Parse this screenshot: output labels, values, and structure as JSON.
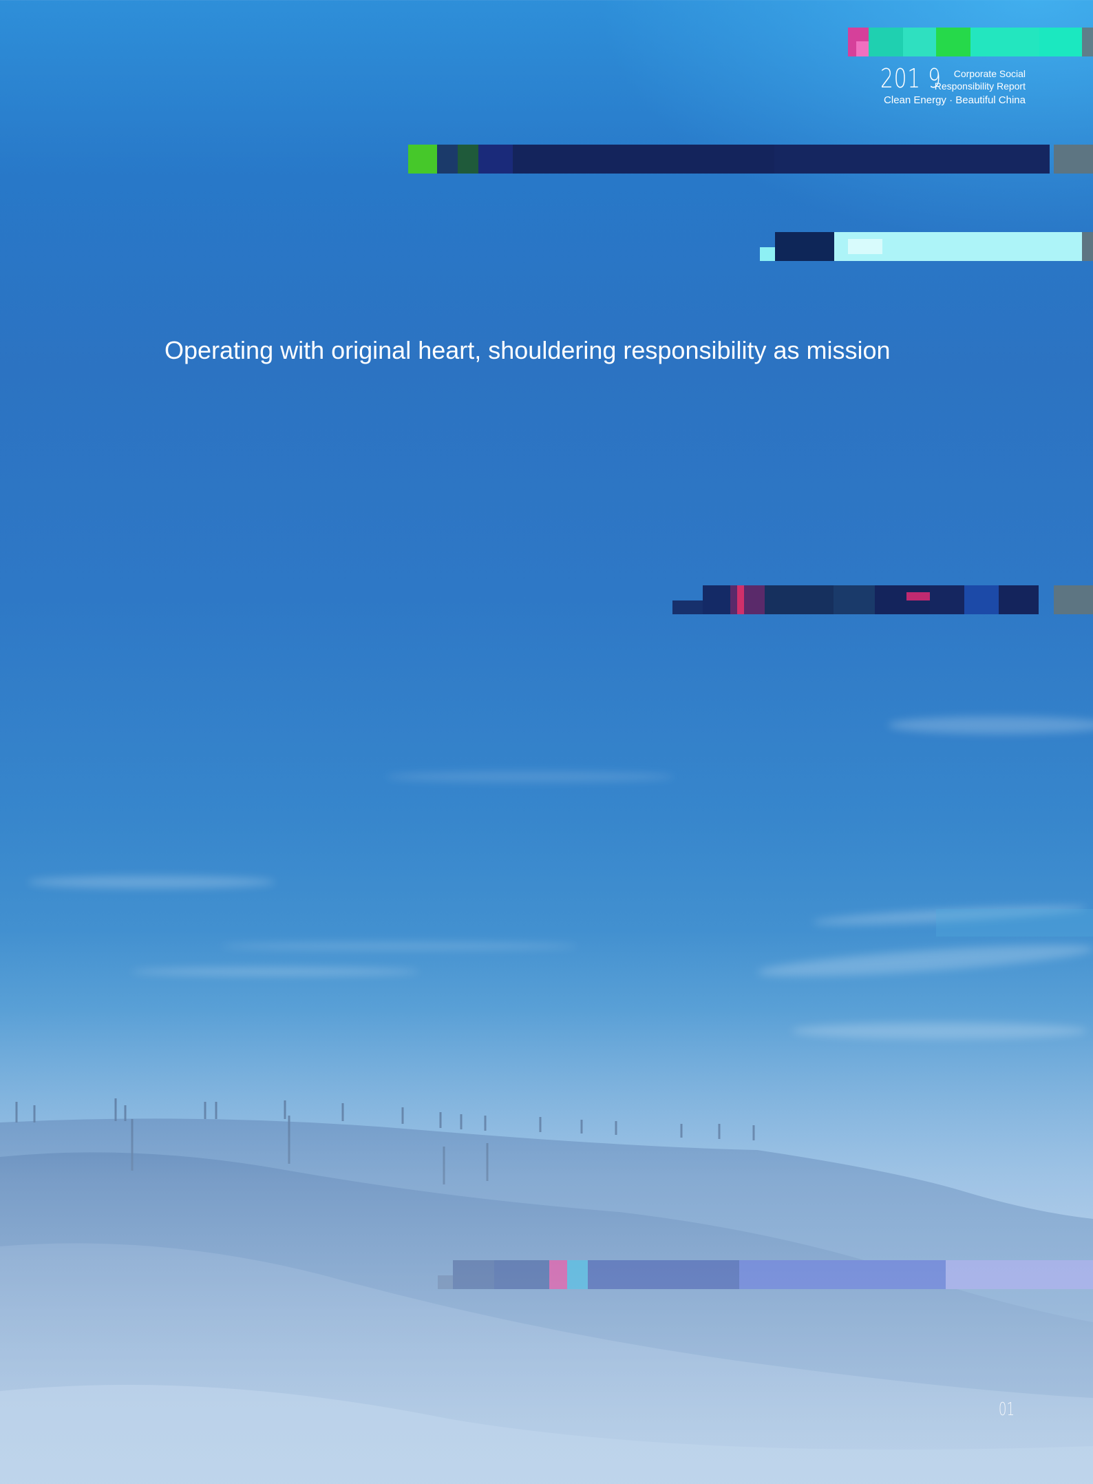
{
  "report": {
    "year": "201 9",
    "title_line1": "Corporate Social",
    "title_line2": "Responsibility Report",
    "subtitle": "Clean Energy · Beautiful China"
  },
  "slogan": "Operating with original heart, shouldering responsibility as mission",
  "page_number": "01",
  "colors": {
    "sky_top": "#2e8fd9",
    "sky_mid": "#2c73c2",
    "haze": "#a6c4e3",
    "bar_dark": "#14245c",
    "bar_cyan": "#adf4f8",
    "bar_green": "#18e8b0"
  }
}
